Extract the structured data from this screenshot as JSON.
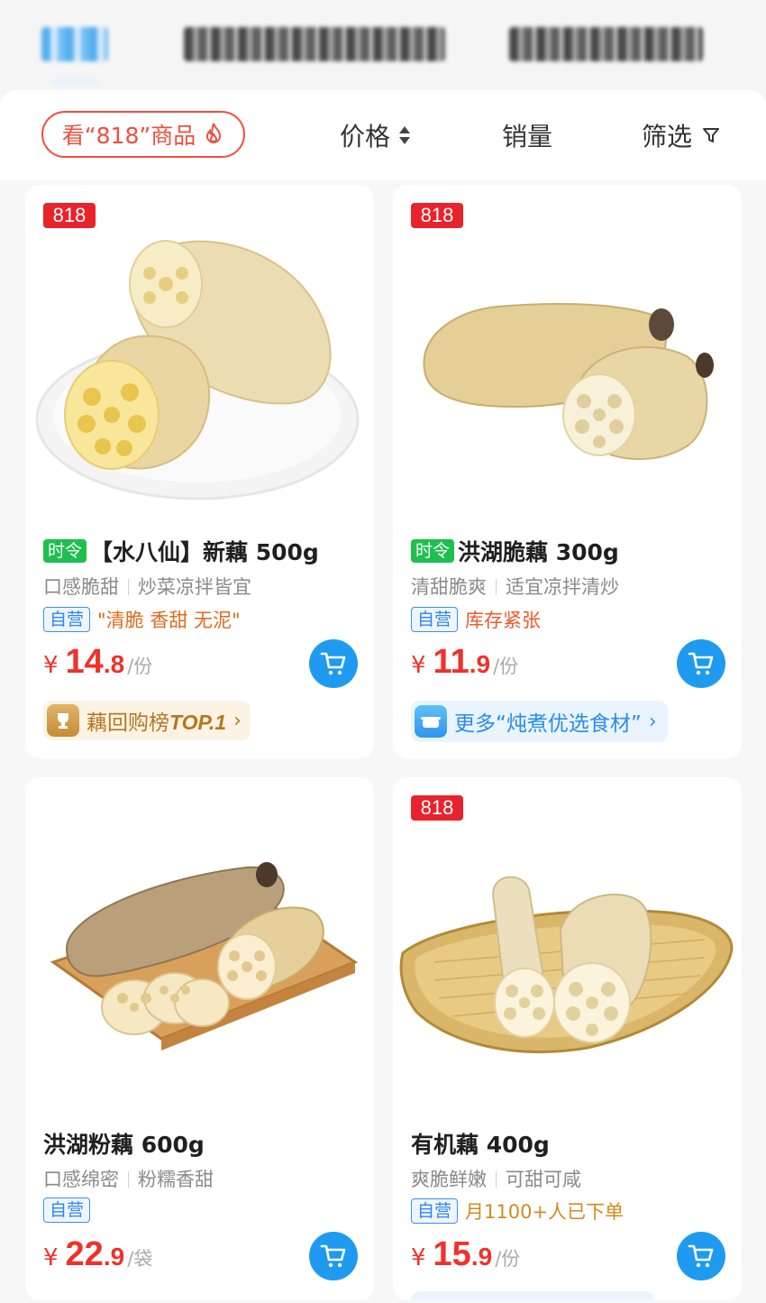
{
  "filter_bar": {
    "promo_label": "看“818”商品",
    "price_label": "价格",
    "sales_label": "销量",
    "filter_label": "筛选"
  },
  "products": [
    {
      "badge": "818",
      "tag": "时令",
      "title": "【水八仙】新藕 500g",
      "desc1": "口感脆甜",
      "desc2": "炒菜凉拌皆宜",
      "self_label": "自营",
      "note": "\"清脆 香甜 无泥\"",
      "price_int": "14",
      "price_dec": ".8",
      "unit": "/份",
      "rank_text": "藕回购榜",
      "rank_top": "TOP.1"
    },
    {
      "badge": "818",
      "tag": "时令",
      "title": "洪湖脆藕 300g",
      "desc1": "清甜脆爽",
      "desc2": "适宜凉拌清炒",
      "self_label": "自营",
      "note": "库存紧张",
      "price_int": "11",
      "price_dec": ".9",
      "unit": "/份",
      "more_text": "更多“炖煮优选食材”"
    },
    {
      "title": "洪湖粉藕 600g",
      "desc1": "口感绵密",
      "desc2": "粉糯香甜",
      "self_label": "自营",
      "price_int": "22",
      "price_dec": ".9",
      "unit": "/袋"
    },
    {
      "badge": "818",
      "title": "有机藕 400g",
      "desc1": "爽脆鲜嫩",
      "desc2": "可甜可咸",
      "self_label": "自营",
      "note": "月1100+人已下单",
      "price_int": "15",
      "price_dec": ".9",
      "unit": "/份"
    }
  ],
  "colors": {
    "accent_blue": "#1e9bf0",
    "price_red": "#f0312a",
    "badge_red": "#e8232b",
    "tag_green": "#1fbf4f"
  }
}
